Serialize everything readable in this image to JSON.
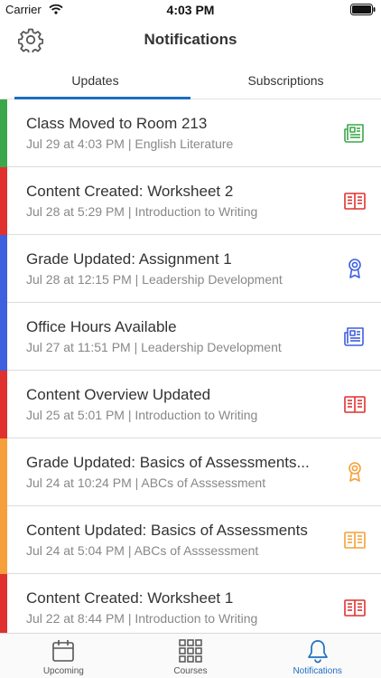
{
  "status": {
    "carrier": "Carrier",
    "time": "4:03 PM"
  },
  "nav": {
    "title": "Notifications"
  },
  "tabs": [
    {
      "label": "Updates",
      "active": true
    },
    {
      "label": "Subscriptions",
      "active": false
    }
  ],
  "notifications": [
    {
      "title": "Class Moved to Room 213",
      "subtitle": "Jul 29 at 4:03 PM | English Literature",
      "color": "#3aa84a",
      "icon": "newspaper-icon"
    },
    {
      "title": "Content Created: Worksheet 2",
      "subtitle": "Jul 28 at 5:29 PM | Introduction to Writing",
      "color": "#e0312f",
      "icon": "book-icon"
    },
    {
      "title": "Grade Updated: Assignment 1",
      "subtitle": "Jul 28 at 12:15 PM | Leadership Development",
      "color": "#3e5fe0",
      "icon": "award-ribbon-icon"
    },
    {
      "title": "Office Hours Available",
      "subtitle": "Jul 27 at 11:51 PM | Leadership Development",
      "color": "#3e5fe0",
      "icon": "newspaper-icon"
    },
    {
      "title": "Content Overview Updated",
      "subtitle": "Jul 25 at 5:01 PM | Introduction to Writing",
      "color": "#e0312f",
      "icon": "book-icon"
    },
    {
      "title": "Grade Updated: Basics of Assessments...",
      "subtitle": "Jul 24 at 10:24 PM | ABCs of Asssessment",
      "color": "#f5a03a",
      "icon": "award-ribbon-icon"
    },
    {
      "title": "Content Updated: Basics of Assessments",
      "subtitle": "Jul 24 at 5:04 PM | ABCs of Asssessment",
      "color": "#f5a03a",
      "icon": "book-icon"
    },
    {
      "title": "Content Created: Worksheet 1",
      "subtitle": "Jul 22 at 8:44 PM | Introduction to Writing",
      "color": "#e0312f",
      "icon": "book-icon"
    }
  ],
  "tabbar": [
    {
      "label": "Upcoming",
      "icon": "calendar-icon",
      "active": false
    },
    {
      "label": "Courses",
      "icon": "grid-icon",
      "active": false
    },
    {
      "label": "Notifications",
      "icon": "bell-icon",
      "active": true
    }
  ],
  "colors": {
    "accent": "#1c6fc1",
    "active_tab": "#1c6fc1"
  }
}
